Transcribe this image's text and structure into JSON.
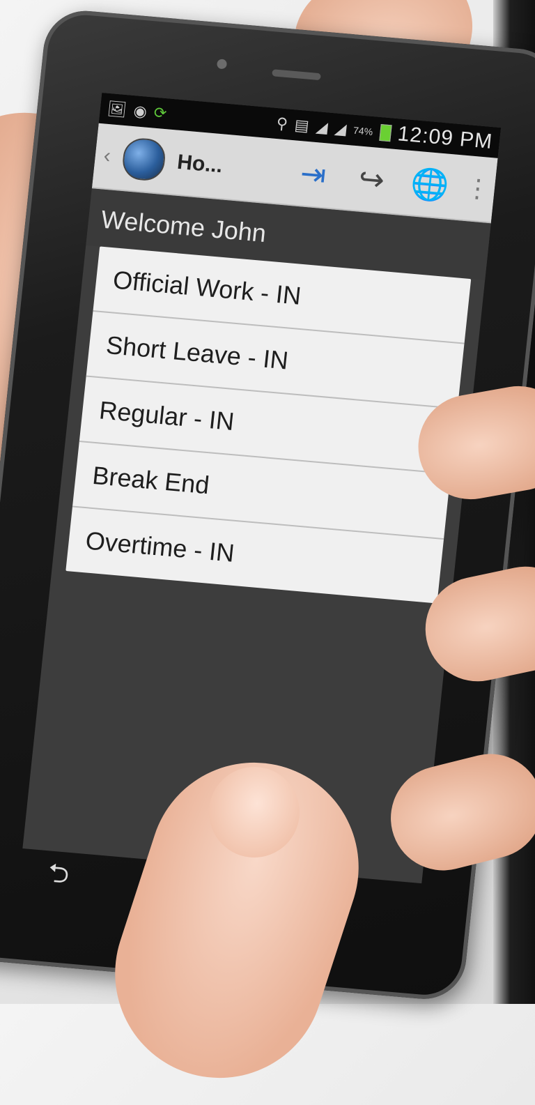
{
  "status_bar": {
    "left_icons": [
      "image-icon",
      "whatsapp-icon",
      "sync-icon"
    ],
    "signal_icons": [
      "wifi-icon",
      "file-icon",
      "signal-icon",
      "signal-icon"
    ],
    "battery_percent": "74%",
    "time": "12:09 PM"
  },
  "action_bar": {
    "back_glyph": "‹",
    "title": "Ho...",
    "buttons": [
      {
        "name": "check-in-button",
        "icon": "login-icon",
        "glyph": "⇥"
      },
      {
        "name": "check-out-button",
        "icon": "logout-icon",
        "glyph": "↪"
      },
      {
        "name": "globe-button",
        "icon": "globe-icon",
        "glyph": "🌐"
      }
    ],
    "overflow_glyph": "⋮"
  },
  "welcome": "Welcome John",
  "options": [
    "Official Work - IN",
    "Short Leave - IN",
    "Regular - IN",
    "Break End",
    "Overtime - IN"
  ],
  "nav": {
    "back_glyph": "⮌"
  },
  "colors": {
    "accent": "#2a6fc9",
    "screen_bg": "#3d3d3d",
    "list_bg": "#f0f0f0",
    "action_bar_bg": "#dadada",
    "battery": "#6ad032"
  }
}
